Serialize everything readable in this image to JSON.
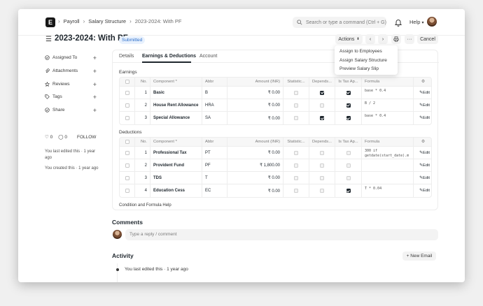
{
  "topnav": {
    "logo": "E",
    "breadcrumbs": [
      "Payroll",
      "Salary Structure",
      "2023-2024: With PF"
    ],
    "search_placeholder": "Search or type a command (Ctrl + G)",
    "help_label": "Help"
  },
  "page": {
    "title": "2023-2024: With PF",
    "status": "Submitted",
    "actions_label": "Actions",
    "cancel_label": "Cancel",
    "actions_menu": [
      "Assign to Employees",
      "Assign Salary Structure",
      "Preview Salary Slip"
    ]
  },
  "sidebar": {
    "items": [
      {
        "label": "Assigned To",
        "icon": "assign-icon"
      },
      {
        "label": "Attachments",
        "icon": "paperclip-icon"
      },
      {
        "label": "Reviews",
        "icon": "star-icon"
      },
      {
        "label": "Tags",
        "icon": "tag-icon"
      },
      {
        "label": "Share",
        "icon": "share-icon"
      }
    ],
    "likes": "0",
    "comments": "0",
    "follow_label": "FOLLOW",
    "edited_note": "You last edited this · 1 year ago",
    "created_note": "You created this · 1 year ago"
  },
  "form": {
    "tabs": [
      "Details",
      "Earnings & Deductions",
      "Account"
    ],
    "active_tab": "Earnings & Deductions",
    "columns": [
      "No.",
      "Component *",
      "Abbr",
      "Amount (INR)",
      "Statistic...",
      "Depends...",
      "Is Tax Ap...",
      "Formula"
    ],
    "earnings_label": "Earnings",
    "deductions_label": "Deductions",
    "edit_label": "Edit",
    "earnings": [
      {
        "no": "1",
        "component": "Basic",
        "abbr": "B",
        "amount": "₹ 0.00",
        "statistical": false,
        "depends": true,
        "tax": true,
        "formula": "base * 0.4"
      },
      {
        "no": "2",
        "component": "House Rent Allowance",
        "abbr": "HRA",
        "amount": "₹ 0.00",
        "statistical": false,
        "depends": false,
        "tax": true,
        "formula": "B / 2"
      },
      {
        "no": "3",
        "component": "Special Allowance",
        "abbr": "SA",
        "amount": "₹ 0.00",
        "statistical": false,
        "depends": true,
        "tax": true,
        "formula": "base * 0.4"
      }
    ],
    "deductions": [
      {
        "no": "1",
        "component": "Professional Tax",
        "abbr": "PT",
        "amount": "₹ 0.00",
        "statistical": false,
        "depends": false,
        "tax": false,
        "formula": "300 if getdate(start_date).m"
      },
      {
        "no": "2",
        "component": "Provident Fund",
        "abbr": "PF",
        "amount": "₹ 1,800.00",
        "statistical": false,
        "depends": false,
        "tax": false,
        "formula": ""
      },
      {
        "no": "3",
        "component": "TDS",
        "abbr": "T",
        "amount": "₹ 0.00",
        "statistical": false,
        "depends": false,
        "tax": false,
        "formula": ""
      },
      {
        "no": "4",
        "component": "Education Cess",
        "abbr": "EC",
        "amount": "₹ 0.00",
        "statistical": false,
        "depends": false,
        "tax": true,
        "formula": "T * 0.04"
      }
    ],
    "help_link": "Condition and Formula Help"
  },
  "comments": {
    "title": "Comments",
    "placeholder": "Type a reply / comment"
  },
  "activity": {
    "title": "Activity",
    "new_email_label": "+ New Email",
    "entry": "You last edited this · 1 year ago"
  }
}
